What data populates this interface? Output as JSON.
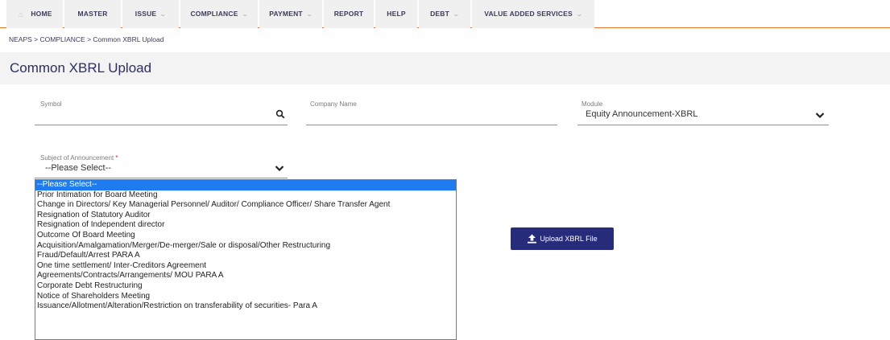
{
  "nav": {
    "items": [
      {
        "label": "HOME",
        "has_menu": false
      },
      {
        "label": "MASTER",
        "has_menu": false
      },
      {
        "label": "ISSUE",
        "has_menu": true
      },
      {
        "label": "COMPLIANCE",
        "has_menu": true
      },
      {
        "label": "PAYMENT",
        "has_menu": true
      },
      {
        "label": "REPORT",
        "has_menu": false
      },
      {
        "label": "HELP",
        "has_menu": false
      },
      {
        "label": "DEBT",
        "has_menu": true
      },
      {
        "label": "VALUE ADDED SERVICES",
        "has_menu": true
      }
    ]
  },
  "breadcrumb": "NEAPS > COMPLIANCE > Common XBRL Upload",
  "page_title": "Common XBRL Upload",
  "form": {
    "symbol": {
      "label": "Symbol",
      "value": ""
    },
    "company_name": {
      "label": "Company Name",
      "value": ""
    },
    "module": {
      "label": "Module",
      "value": "Equity Announcement-XBRL"
    },
    "subject": {
      "label": "Subject of Announcement",
      "required_mark": "*",
      "value": "--Please Select--"
    }
  },
  "upload_button": {
    "label": "Upload XBRL File",
    "icon": "upload-icon"
  },
  "dropdown": {
    "selected_index": 0,
    "options": [
      "--Please Select--",
      "Prior Intimation for Board Meeting",
      "Change in Directors/ Key Managerial Personnel/ Auditor/ Compliance Officer/ Share Transfer Agent",
      "Resignation of Statutory Auditor",
      "Resignation of Independent director",
      "Outcome Of Board Meeting",
      "Acquisition/Amalgamation/Merger/De-merger/Sale or disposal/Other Restructuring",
      "Fraud/Default/Arrest PARA A",
      "One time settlement/ Inter-Creditors Agreement",
      "Agreements/Contracts/Arrangements/ MOU PARA A",
      "Corporate Debt Restructuring",
      "Notice of Shareholders Meeting",
      "Issuance/Allotment/Alteration/Restriction on transferability of securities- Para A"
    ]
  },
  "colors": {
    "accent_orange": "#e8742a",
    "brand_navy": "#262b7a",
    "title_color": "#2e2e62",
    "dropdown_highlight": "#1e7cf0"
  }
}
